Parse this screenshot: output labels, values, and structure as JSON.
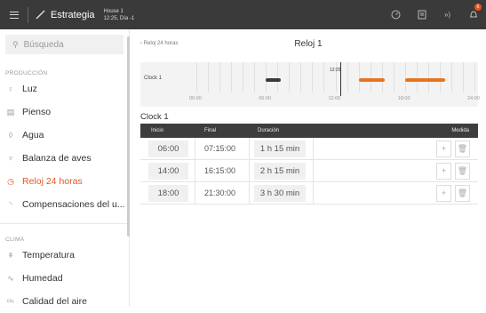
{
  "topbar": {
    "app_name": "Estrategia",
    "house_name": "House 1",
    "house_day": "12:25, Día -1",
    "notification_count": "6"
  },
  "sidebar": {
    "search_placeholder": "Búsqueda",
    "sections": [
      {
        "title": "PRODUCCIÓN",
        "items": [
          {
            "label": "Luz",
            "icon": "bulb-icon"
          },
          {
            "label": "Pienso",
            "icon": "feed-icon"
          },
          {
            "label": "Agua",
            "icon": "water-drop-icon"
          },
          {
            "label": "Balanza de aves",
            "icon": "bird-scale-icon"
          },
          {
            "label": "Reloj 24 horas",
            "icon": "clock-icon",
            "active": true
          },
          {
            "label": "Compensaciones del u...",
            "icon": "compensation-icon"
          }
        ]
      },
      {
        "title": "CLIMA",
        "items": [
          {
            "label": "Temperatura",
            "icon": "thermometer-icon"
          },
          {
            "label": "Humedad",
            "icon": "humidity-icon"
          },
          {
            "label": "Calidad del aire",
            "icon": "co2-icon"
          }
        ]
      }
    ]
  },
  "main": {
    "breadcrumb": "‹ Reloj 24 horas",
    "title": "Reloj 1",
    "timeline": {
      "label": "Clock 1",
      "hours": [
        "00:00",
        "06:00",
        "12:00",
        "18:00",
        "24:00"
      ],
      "now_label": "12:25",
      "now_hour": 12.42,
      "bars": [
        {
          "start": 6.0,
          "end": 7.25,
          "color": "#3a3a3a"
        },
        {
          "start": 14.0,
          "end": 16.25,
          "color": "#e8731f"
        },
        {
          "start": 18.0,
          "end": 21.5,
          "color": "#e8731f"
        }
      ]
    },
    "clock_title": "Clock 1",
    "columns": {
      "start": "Inicio",
      "end": "Final",
      "duration": "Duración",
      "measure": "Medida"
    },
    "rows": [
      {
        "start": "06:00",
        "end": "07:15:00",
        "duration": "1 h 15 min"
      },
      {
        "start": "14:00",
        "end": "16:15:00",
        "duration": "2 h 15 min"
      },
      {
        "start": "18:00",
        "end": "21:30:00",
        "duration": "3 h 30 min"
      }
    ]
  }
}
